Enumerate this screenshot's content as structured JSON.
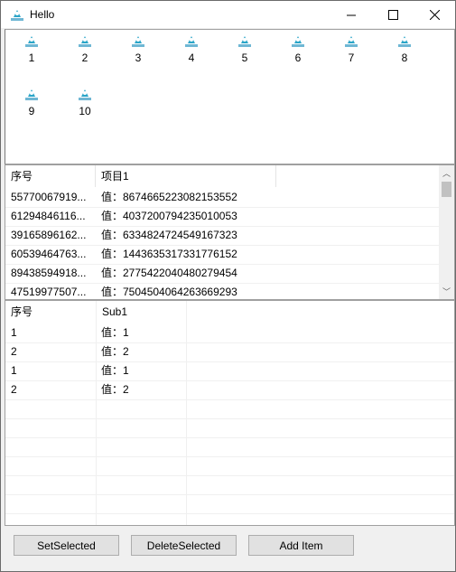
{
  "window": {
    "title": "Hello"
  },
  "icon_view": {
    "items": [
      "1",
      "2",
      "3",
      "4",
      "5",
      "6",
      "7",
      "8",
      "9",
      "10"
    ]
  },
  "list1": {
    "columns": [
      "序号",
      "项目1"
    ],
    "rows": [
      [
        "55770067919...",
        "值：8674665223082153552"
      ],
      [
        "61294846116...",
        "值：4037200794235010053"
      ],
      [
        "39165896162...",
        "值：6334824724549167323"
      ],
      [
        "60539464763...",
        "值：1443635317331776152"
      ],
      [
        "89438594918...",
        "值：2775422040480279454"
      ],
      [
        "47519977507...",
        "值：7504504064263669293"
      ]
    ]
  },
  "list2": {
    "columns": [
      "序号",
      "Sub1"
    ],
    "rows": [
      [
        "1",
        "值：1"
      ],
      [
        "2",
        "值：2"
      ],
      [
        "1",
        "值：1"
      ],
      [
        "2",
        "值：2"
      ]
    ]
  },
  "buttons": {
    "set_selected": "SetSelected",
    "delete_selected": "DeleteSelected",
    "add_item": "Add Item"
  },
  "colors": {
    "icon_teal": "#2aa5c8",
    "border": "#a0a0a0"
  }
}
